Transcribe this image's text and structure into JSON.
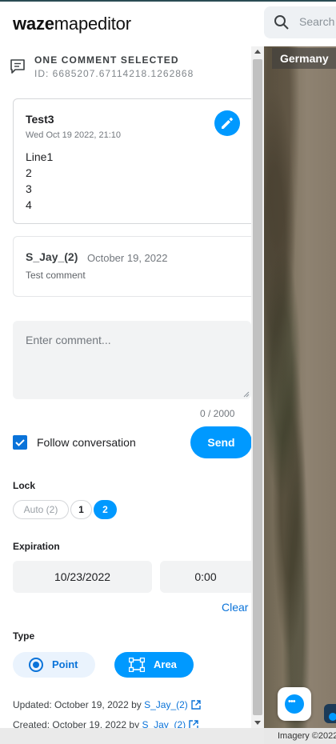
{
  "header": {
    "logo_waze": "waze",
    "logo_rest": "mapeditor",
    "search_placeholder": "Search"
  },
  "selection": {
    "title": "ONE COMMENT SELECTED",
    "id": "ID: 6685207.67114218.1262868"
  },
  "comment": {
    "title": "Test3",
    "date": "Wed Oct 19 2022, 21:10",
    "lines": [
      "Line1",
      "2",
      "3",
      "4"
    ]
  },
  "reply": {
    "user": "S_Jay_(2)",
    "date": "October 19, 2022",
    "text": "Test comment"
  },
  "composer": {
    "placeholder": "Enter comment...",
    "counter": "0 / 2000",
    "follow_label": "Follow conversation",
    "follow_checked": true,
    "send_label": "Send"
  },
  "lock": {
    "label": "Lock",
    "options": [
      "Auto (2)",
      "1",
      "2"
    ],
    "selected": "2"
  },
  "expiration": {
    "label": "Expiration",
    "date": "10/23/2022",
    "time": "0:00",
    "clear_label": "Clear"
  },
  "type": {
    "label": "Type",
    "point_label": "Point",
    "area_label": "Area",
    "selected": "Area"
  },
  "meta": {
    "updated_prefix": "Updated: October 19, 2022 by ",
    "updated_user": "S_Jay_(2)",
    "created_prefix": "Created: October 19, 2022 by ",
    "created_user": "S_Jay_(2)"
  },
  "map": {
    "country": "Germany",
    "credit": "Imagery ©2022"
  },
  "colors": {
    "accent": "#0099ff",
    "link": "#0a73d9"
  }
}
